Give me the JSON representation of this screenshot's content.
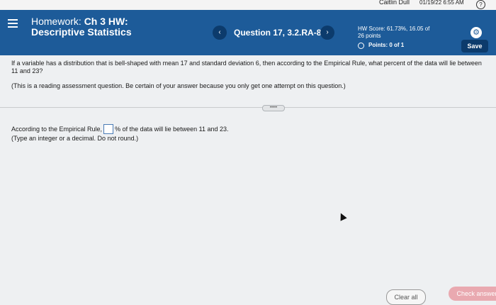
{
  "topbar": {
    "user": "Caitlin Dull",
    "datetime": "01/19/22 6:55 AM",
    "help_glyph": "?"
  },
  "header": {
    "homework_label": "Homework:",
    "homework_name": "Ch 3 HW:",
    "homework_subtitle": "Descriptive Statistics",
    "question_label": "Question 17, 3.2.RA-8",
    "prev_glyph": "‹",
    "next_glyph": "›",
    "hw_score": "HW Score: 61.73%, 16.05 of",
    "hw_score_2": "26 points",
    "points": "Points: 0 of 1",
    "gear_glyph": "⚙",
    "save_label": "Save"
  },
  "question": {
    "text": "If a variable has a distribution that is bell-shaped with mean 17 and standard deviation 6, then according to the Empirical Rule, what percent of the data will lie between 11 and 23?",
    "note": "(This is a reading assessment question. Be certain of your answer because you only get one attempt on this question.)"
  },
  "more_pill": "•••••",
  "answer": {
    "prefix": "According to the Empirical Rule,",
    "suffix": "% of the data will lie between 11 and 23.",
    "hint": "(Type an integer or a decimal. Do not round.)",
    "value": ""
  },
  "footer": {
    "clear_label": "Clear all",
    "check_label": "Check answer"
  },
  "colors": {
    "header_bg": "#1d5b99",
    "button_dark": "#0c3b6c",
    "check_button": "#e9a9b0"
  }
}
